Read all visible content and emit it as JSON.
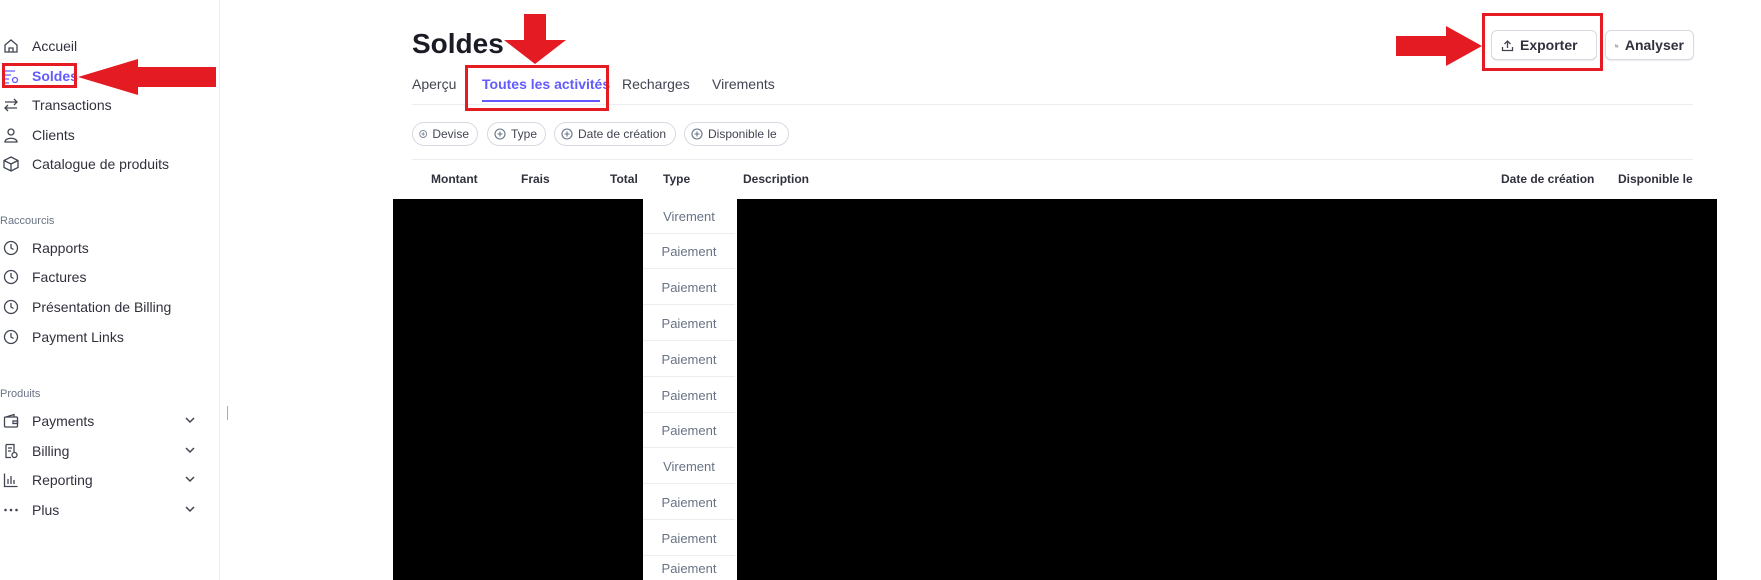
{
  "sidebar": {
    "items": [
      {
        "label": "Accueil",
        "icon": "home-icon"
      },
      {
        "label": "Soldes",
        "icon": "balance-icon",
        "active": true
      },
      {
        "label": "Transactions",
        "icon": "transactions-icon"
      },
      {
        "label": "Clients",
        "icon": "user-icon"
      },
      {
        "label": "Catalogue de produits",
        "icon": "box-icon"
      }
    ],
    "shortcuts_label": "Raccourcis",
    "shortcuts": [
      {
        "label": "Rapports",
        "icon": "clock-icon"
      },
      {
        "label": "Factures",
        "icon": "clock-icon"
      },
      {
        "label": "Présentation de Billing",
        "icon": "clock-icon"
      },
      {
        "label": "Payment Links",
        "icon": "clock-icon"
      }
    ],
    "products_label": "Produits",
    "products": [
      {
        "label": "Payments",
        "icon": "wallet-icon"
      },
      {
        "label": "Billing",
        "icon": "billing-icon"
      },
      {
        "label": "Reporting",
        "icon": "chart-icon"
      },
      {
        "label": "Plus",
        "icon": "ellipsis-icon"
      }
    ]
  },
  "page": {
    "title": "Soldes",
    "tabs": [
      {
        "label": "Aperçu"
      },
      {
        "label": "Toutes les activités",
        "active": true
      },
      {
        "label": "Recharges"
      },
      {
        "label": "Virements"
      }
    ],
    "filters": [
      {
        "label": "Devise"
      },
      {
        "label": "Type"
      },
      {
        "label": "Date de création"
      },
      {
        "label": "Disponible le"
      }
    ],
    "actions": {
      "export_label": "Exporter",
      "analyze_label": "Analyser"
    }
  },
  "table": {
    "columns": [
      "Montant",
      "Frais",
      "Total",
      "Type",
      "Description",
      "Date de création",
      "Disponible le"
    ],
    "types": [
      "Virement",
      "Paiement",
      "Paiement",
      "Paiement",
      "Paiement",
      "Paiement",
      "Paiement",
      "Virement",
      "Paiement",
      "Paiement",
      "Paiement"
    ]
  },
  "colors": {
    "accent": "#635bff",
    "annotation_red": "#e51b23",
    "redaction": "#000000"
  }
}
